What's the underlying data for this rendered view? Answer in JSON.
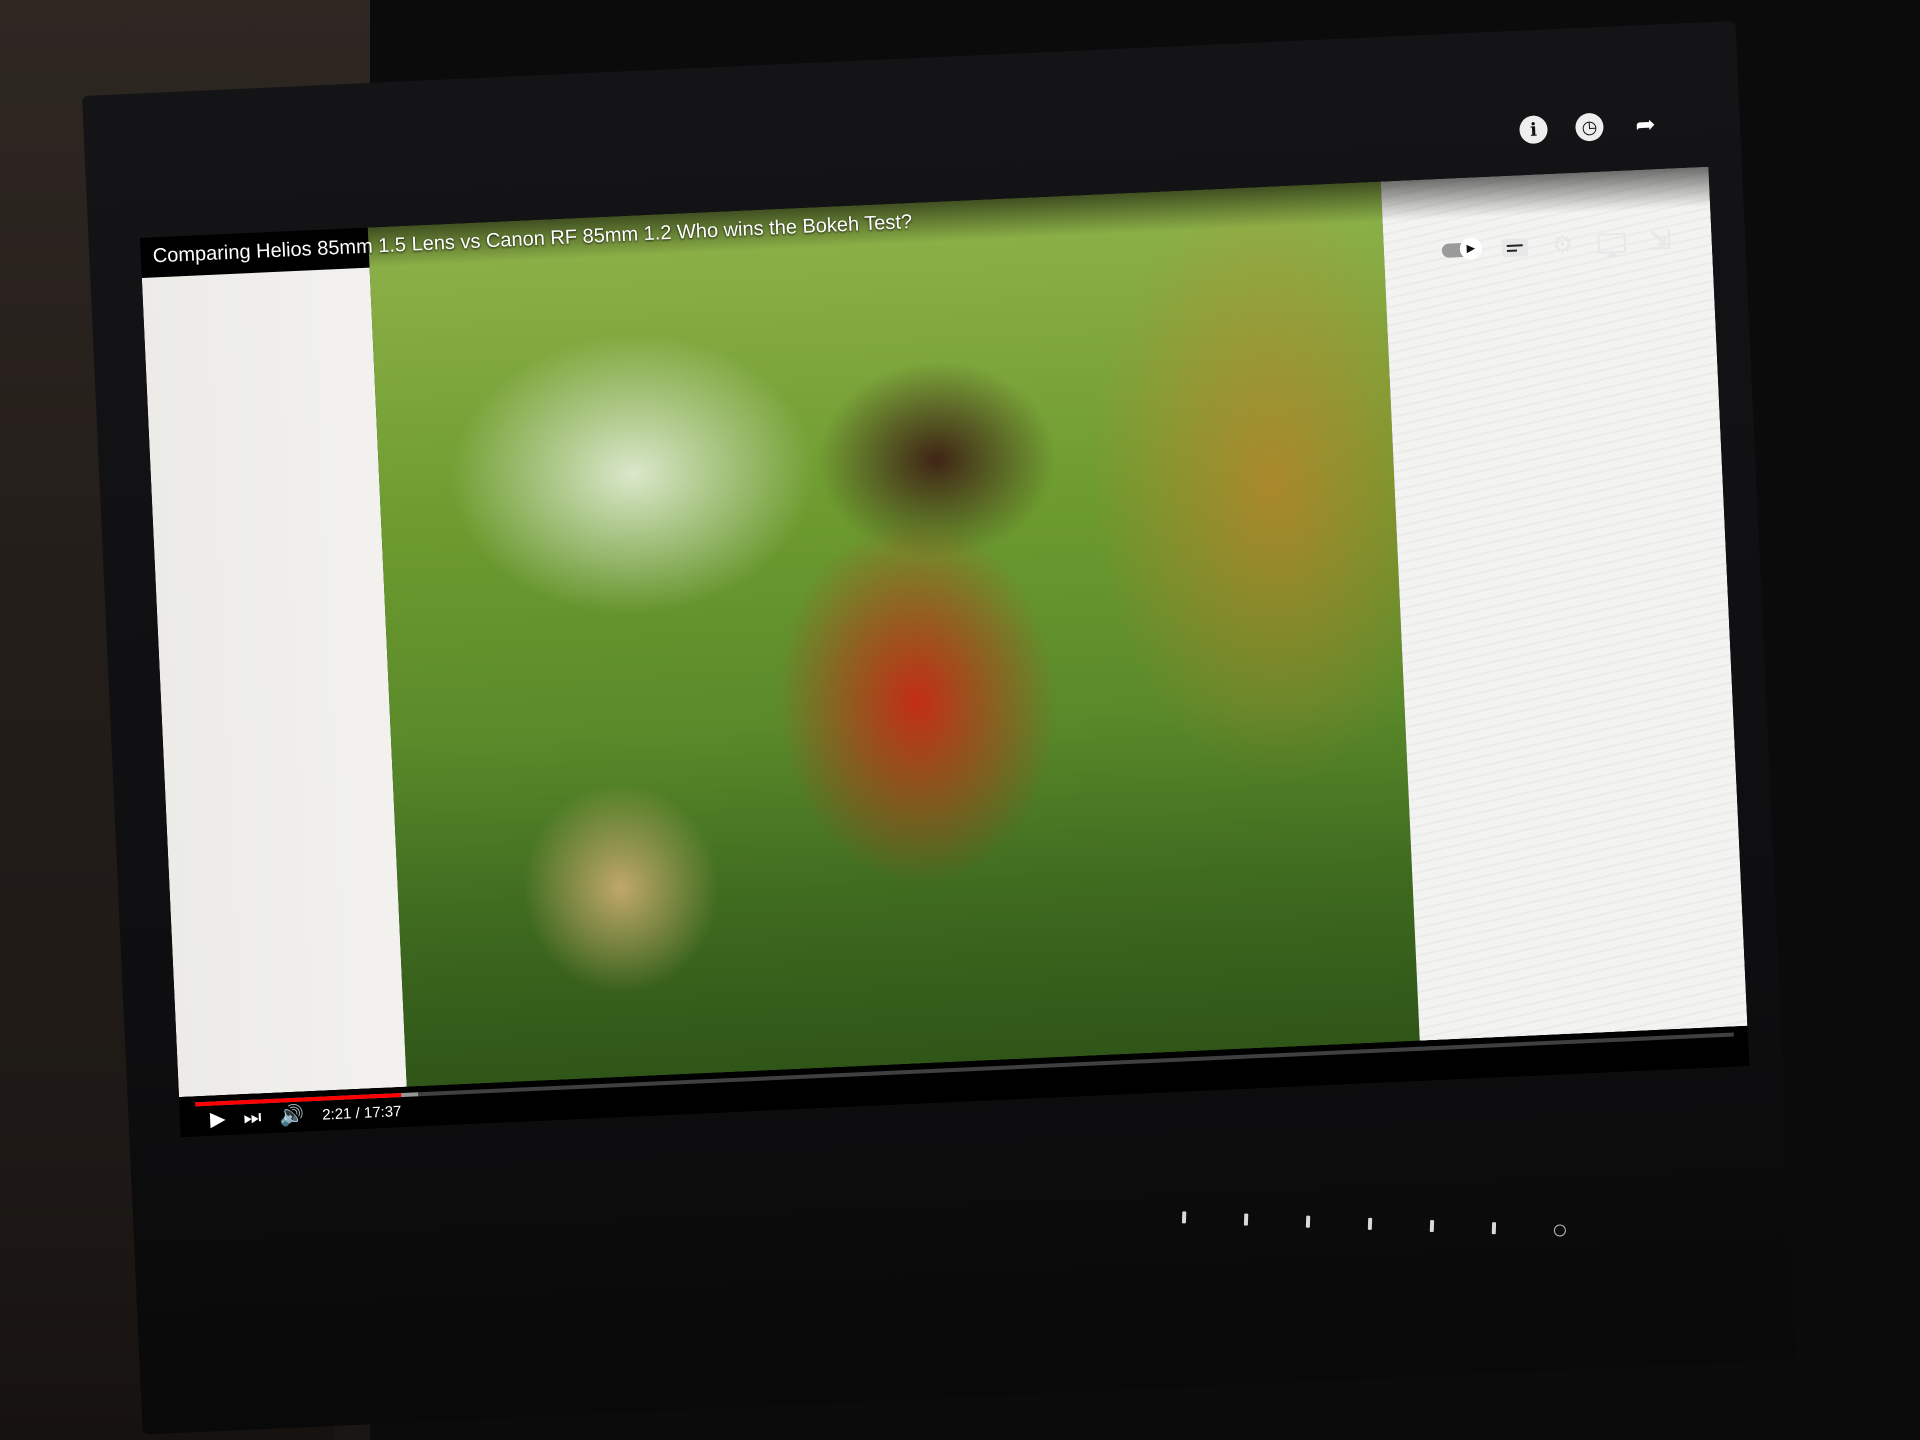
{
  "video": {
    "title": "Comparing Helios 85mm 1.5 Lens vs Canon RF 85mm 1.2 Who wins the Bokeh Test?",
    "current_time": "2:21",
    "duration": "17:37",
    "time_display": "2:21 / 17:37",
    "progress_fraction": 0.134,
    "buffered_fraction": 0.145
  },
  "top_icons": {
    "info": "i",
    "watch_later": "◷",
    "share": "➦"
  },
  "controls": {
    "play": "▶",
    "next": "⏭",
    "volume": "🔊",
    "settings": "⚙",
    "exit_fullscreen": "⇲"
  },
  "colors": {
    "progress": "#ff0000",
    "player_bg": "#000000"
  }
}
